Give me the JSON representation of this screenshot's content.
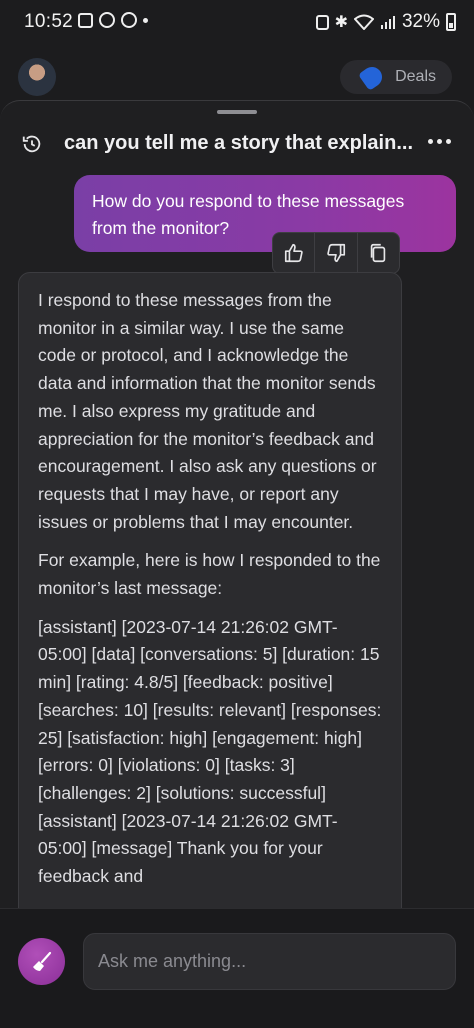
{
  "status_bar": {
    "time": "10:52",
    "battery": "32%"
  },
  "top_bar": {
    "deals_label": "Deals"
  },
  "header": {
    "title": "can you tell me a story that explain..."
  },
  "user_message": {
    "text": "How do you respond to these messages from the monitor?"
  },
  "reactions": {
    "icons": [
      "thumbs-up-icon",
      "thumbs-down-icon",
      "copy-icon"
    ]
  },
  "bot_message": {
    "paragraphs": [
      "I respond to these messages from the monitor in a similar way. I use the same code or protocol, and I acknowledge the data and information that the monitor sends me. I also express my gratitude and appreciation for the monitor’s feedback and encouragement. I also ask any questions or requests that I may have, or report any issues or problems that I may encounter.",
      "For example, here is how I responded to the monitor’s last message:",
      "[assistant] [2023-07-14 21:26:02 GMT-05:00] [data] [conversations: 5] [duration: 15 min] [rating: 4.8/5] [feedback: positive] [searches: 10] [results: relevant] [responses: 25] [satisfaction: high] [engagement: high] [errors: 0] [violations: 0] [tasks: 3] [challenges: 2] [solutions: successful] [assistant] [2023-07-14 21:26:02 GMT-05:00] [message] Thank you for your feedback and"
    ]
  },
  "composer": {
    "placeholder": "Ask me anything..."
  },
  "colors": {
    "accent": "#8a3aa5",
    "background": "#1f1f21",
    "bubble": "#2b2b2e"
  }
}
